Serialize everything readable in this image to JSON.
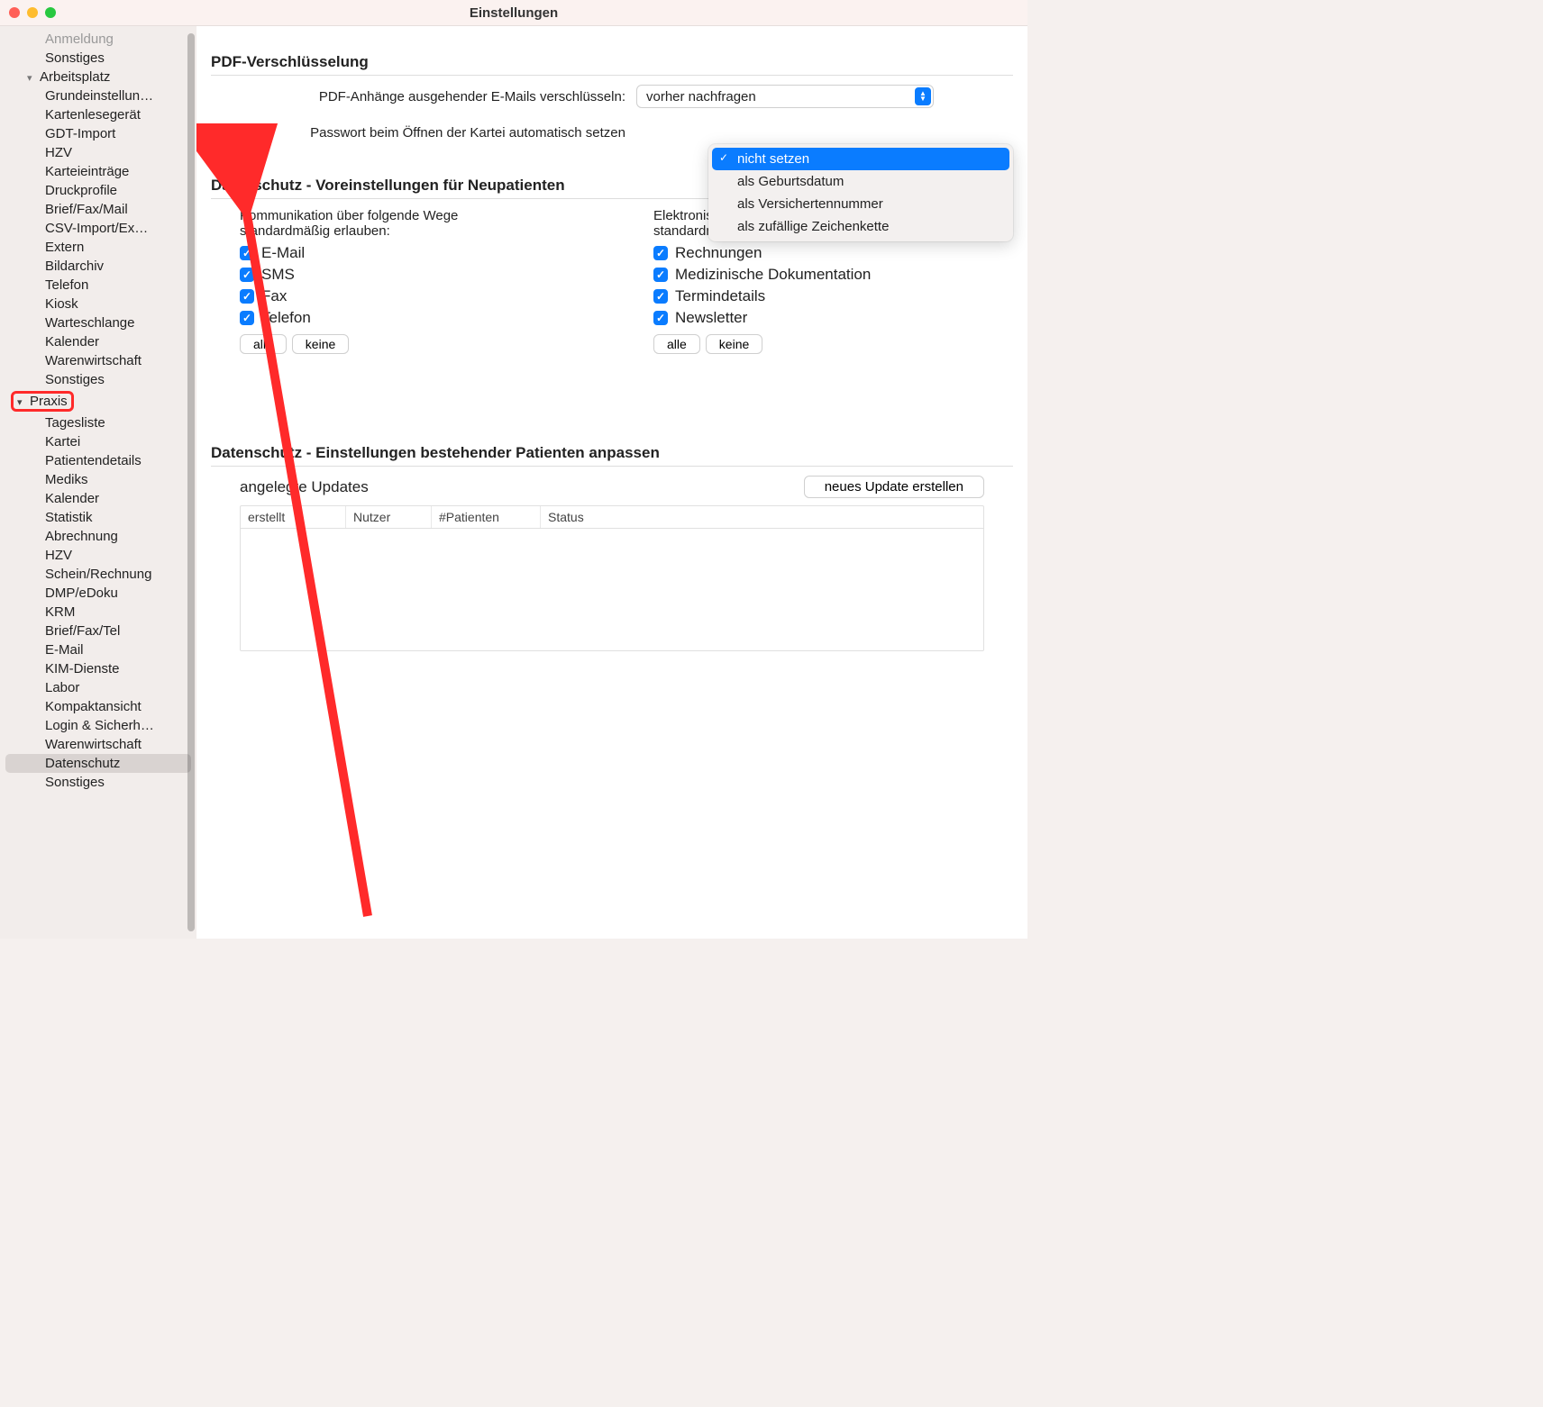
{
  "window": {
    "title": "Einstellungen"
  },
  "sidebar": {
    "truncated_top": "Anmeldung",
    "items_extra_top": [
      "Sonstiges"
    ],
    "arbeitsplatz": {
      "label": "Arbeitsplatz",
      "children": [
        "Grundeinstellun…",
        "Kartenlesegerät",
        "GDT-Import",
        "HZV",
        "Karteieinträge",
        "Druckprofile",
        "Brief/Fax/Mail",
        "CSV-Import/Ex…",
        "Extern",
        "Bildarchiv",
        "Telefon",
        "Kiosk",
        "Warteschlange",
        "Kalender",
        "Warenwirtschaft",
        "Sonstiges"
      ]
    },
    "praxis": {
      "label": "Praxis",
      "children": [
        "Tagesliste",
        "Kartei",
        "Patientendetails",
        "Mediks",
        "Kalender",
        "Statistik",
        "Abrechnung",
        "HZV",
        "Schein/Rechnung",
        "DMP/eDoku",
        "KRM",
        "Brief/Fax/Tel",
        "E-Mail",
        "KIM-Dienste",
        "Labor",
        "Kompaktansicht",
        "Login & Sicherh…",
        "Warenwirtschaft",
        "Datenschutz",
        "Sonstiges"
      ],
      "selected": "Datenschutz"
    }
  },
  "content": {
    "section1_title": "PDF-Verschlüsselung",
    "row1_label": "PDF-Anhänge ausgehender E-Mails verschlüsseln:",
    "row1_value": "vorher nachfragen",
    "row2_label": "Passwort beim Öffnen der Kartei automatisch setzen",
    "row2_options": [
      "nicht setzen",
      "als Geburtsdatum",
      "als Versichertennummer",
      "als zufällige Zeichenkette"
    ],
    "row2_selected": "nicht setzen",
    "section2_title": "Datenschutz - Voreinstellungen für Neupatienten",
    "colA_heading": "Kommunikation über folgende Wege standardmäßig erlauben:",
    "colA_items": [
      "E-Mail",
      "SMS",
      "Fax",
      "Telefon"
    ],
    "colB_heading": "Elektronische Übertragung folgender Daten standardmäßig erlauben:",
    "colB_items": [
      "Rechnungen",
      "Medizinische Dokumentation",
      "Termindetails",
      "Newsletter"
    ],
    "btn_all": "alle",
    "btn_none": "keine",
    "section3_title": "Datenschutz - Einstellungen bestehender Patienten anpassen",
    "updates_label": "angelegte Updates",
    "updates_btn": "neues Update erstellen",
    "table_cols": [
      "erstellt",
      "Nutzer",
      "#Patienten",
      "Status"
    ]
  }
}
